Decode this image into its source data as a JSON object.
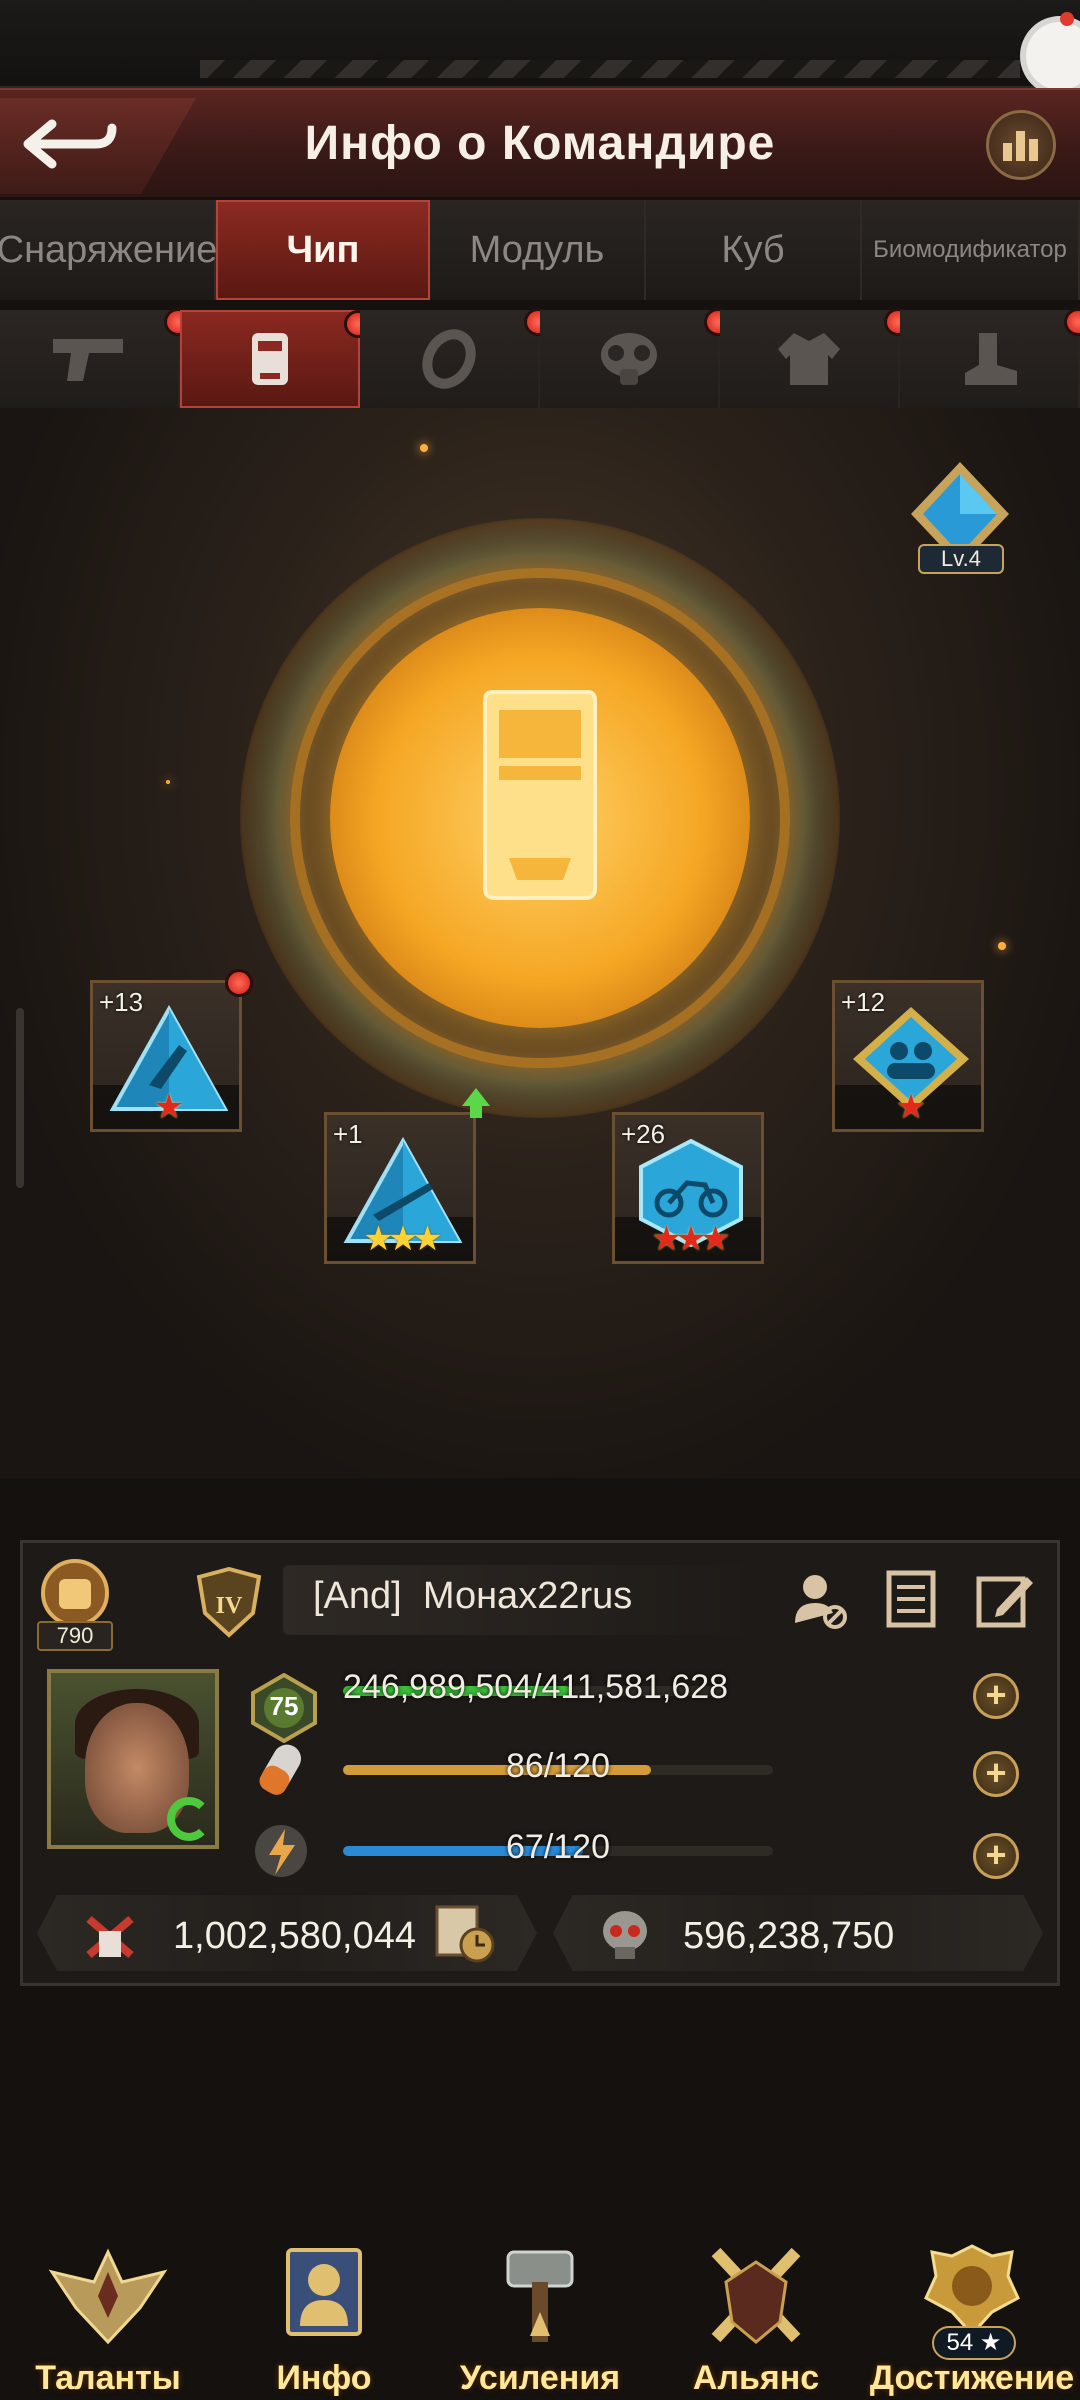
{
  "header": {
    "title": "Инфо о Командире",
    "back_icon": "back-arrow-icon",
    "stats_icon": "bar-chart-icon"
  },
  "tabs": [
    {
      "label": "Снаряжение",
      "active": false
    },
    {
      "label": "Чип",
      "active": true
    },
    {
      "label": "Модуль",
      "active": false
    },
    {
      "label": "Куб",
      "active": false
    },
    {
      "label": "Биомодификатор",
      "active": false
    }
  ],
  "equipment_tabs": [
    {
      "icon": "pistol-icon",
      "active": false,
      "notification": true
    },
    {
      "icon": "chip-armor-icon",
      "active": true,
      "notification": true
    },
    {
      "icon": "ring-icon",
      "active": false,
      "notification": true
    },
    {
      "icon": "gas-mask-icon",
      "active": false,
      "notification": true
    },
    {
      "icon": "jacket-icon",
      "active": false,
      "notification": true
    },
    {
      "icon": "boot-icon",
      "active": false,
      "notification": true
    }
  ],
  "core": {
    "icon": "chip-core-icon",
    "level_label": "Lv.4"
  },
  "chips": [
    {
      "level": "+13",
      "icon": "sniper-triangle-chip-icon",
      "stars": 1,
      "star_color": "red",
      "notification": true
    },
    {
      "level": "+1",
      "icon": "rifle-triangle-chip-icon",
      "stars": 3,
      "star_color": "gold",
      "upgrade": true
    },
    {
      "level": "+26",
      "icon": "motorcycle-hexagon-chip-icon",
      "stars": 3,
      "star_color": "red"
    },
    {
      "level": "+12",
      "icon": "troops-diamond-chip-icon",
      "stars": 1,
      "star_color": "red"
    }
  ],
  "commander": {
    "power_value": "790",
    "rank": "IV",
    "alliance_tag": "[And]",
    "name": "Монах22rus",
    "level": "75",
    "experience": {
      "text": "246,989,504/411,581,628",
      "fraction": 0.6
    },
    "stamina": {
      "text": "86/120",
      "fraction": 0.717
    },
    "energy": {
      "text": "67/120",
      "fraction": 0.558
    },
    "kills": "1,002,580,044",
    "zombie_kills": "596,238,750"
  },
  "colors": {
    "accent_red": "#8c2a22",
    "exp_bar": "#3cbf3a",
    "stamina_bar": "#d39b3a",
    "energy_bar": "#2a8ad6",
    "nav_label": "#ffe89a"
  },
  "nav": [
    {
      "label": "Таланты",
      "icon": "eagle-wings-icon"
    },
    {
      "label": "Инфо",
      "icon": "commander-info-icon"
    },
    {
      "label": "Усиления",
      "icon": "hammer-icon"
    },
    {
      "label": "Альянс",
      "icon": "crossed-swords-icon"
    },
    {
      "label": "Достижение",
      "icon": "lion-trophy-icon",
      "badge": "54 ★"
    }
  ]
}
